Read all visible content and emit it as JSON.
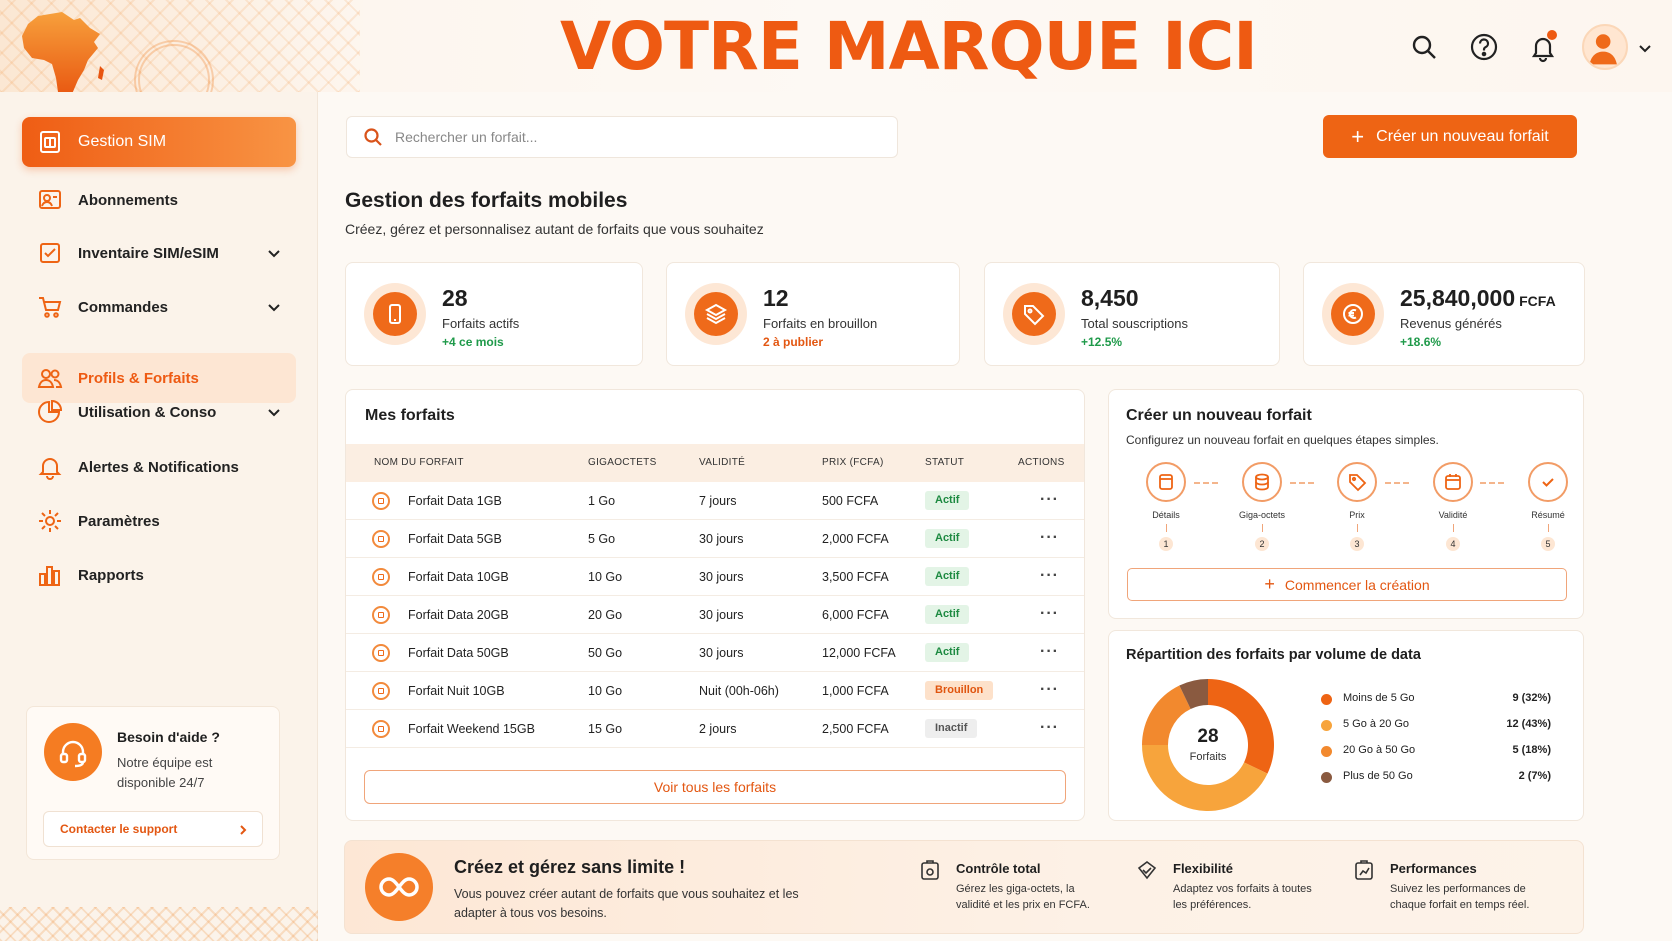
{
  "brand": {
    "title": "VOTRE MARQUE ICI"
  },
  "header": {
    "icons": [
      "search-icon",
      "help-icon",
      "bell-icon",
      "user-icon"
    ]
  },
  "sidebar": {
    "items": [
      {
        "label": "Gestion SIM",
        "icon": "sim-icon",
        "state": "active"
      },
      {
        "label": "Abonnements",
        "icon": "subscription-icon"
      },
      {
        "label": "Inventaire SIM/eSIM",
        "icon": "inventory-icon",
        "expandable": true
      },
      {
        "label": "Commandes",
        "icon": "cart-icon",
        "expandable": true
      },
      {
        "label": "Profils & Forfaits",
        "icon": "users-icon",
        "state": "selected"
      },
      {
        "label": "Utilisation & Conso",
        "icon": "pie-icon",
        "expandable": true
      },
      {
        "label": "Alertes & Notifications",
        "icon": "bell-icon"
      },
      {
        "label": "Paramètres",
        "icon": "gear-icon"
      },
      {
        "label": "Rapports",
        "icon": "report-icon"
      }
    ],
    "help": {
      "title": "Besoin d'aide ?",
      "desc": "Notre équipe est disponible 24/7",
      "button": "Contacter le support"
    }
  },
  "search": {
    "placeholder": "Rechercher un forfait..."
  },
  "create_button": {
    "label": "Créer un nouveau forfait"
  },
  "page": {
    "title": "Gestion des forfaits mobiles",
    "subtitle": "Créez, gérez et personnalisez autant de forfaits que vous souhaitez"
  },
  "stats": [
    {
      "value": "28",
      "unit": "",
      "label": "Forfaits actifs",
      "delta": "+4 ce mois",
      "delta_color": "green"
    },
    {
      "value": "12",
      "unit": "",
      "label": "Forfaits en brouillon",
      "delta": "2 à publier",
      "delta_color": "orange"
    },
    {
      "value": "8,450",
      "unit": "",
      "label": "Total souscriptions",
      "delta": "+12.5%",
      "delta_color": "green"
    },
    {
      "value": "25,840,000",
      "unit": "FCFA",
      "label": "Revenus générés",
      "delta": "+18.6%",
      "delta_color": "green"
    }
  ],
  "table": {
    "title": "Mes forfaits",
    "columns": [
      "NOM DU FORFAIT",
      "GIGAOCTETS",
      "VALIDITÉ",
      "PRIX (FCFA)",
      "STATUT",
      "ACTIONS"
    ],
    "rows": [
      {
        "name": "Forfait Data 1GB",
        "go": "1 Go",
        "validity": "7 jours",
        "price": "500 FCFA",
        "status": "Actif"
      },
      {
        "name": "Forfait Data 5GB",
        "go": "5 Go",
        "validity": "30 jours",
        "price": "2,000 FCFA",
        "status": "Actif"
      },
      {
        "name": "Forfait Data 10GB",
        "go": "10 Go",
        "validity": "30 jours",
        "price": "3,500 FCFA",
        "status": "Actif"
      },
      {
        "name": "Forfait Data 20GB",
        "go": "20 Go",
        "validity": "30 jours",
        "price": "6,000 FCFA",
        "status": "Actif"
      },
      {
        "name": "Forfait Data 50GB",
        "go": "50 Go",
        "validity": "30 jours",
        "price": "12,000 FCFA",
        "status": "Actif"
      },
      {
        "name": "Forfait Nuit 10GB",
        "go": "10 Go",
        "validity": "Nuit (00h-06h)",
        "price": "1,000 FCFA",
        "status": "Brouillon"
      },
      {
        "name": "Forfait Weekend 15GB",
        "go": "15 Go",
        "validity": "2 jours",
        "price": "2,500 FCFA",
        "status": "Inactif"
      }
    ],
    "actions": "···",
    "view_all": "Voir tous les forfaits"
  },
  "wizard": {
    "title": "Créer un nouveau forfait",
    "subtitle": "Configurez un nouveau forfait en quelques étapes simples.",
    "steps": [
      {
        "label": "Détails",
        "num": "1",
        "icon": "document-icon"
      },
      {
        "label": "Giga-octets",
        "num": "2",
        "icon": "database-icon"
      },
      {
        "label": "Prix",
        "num": "3",
        "icon": "tag-icon"
      },
      {
        "label": "Validité",
        "num": "4",
        "icon": "calendar-icon"
      },
      {
        "label": "Résumé",
        "num": "5",
        "icon": "check-icon"
      }
    ],
    "button": "Commencer la création"
  },
  "distribution": {
    "title": "Répartition des forfaits par volume de data",
    "center_value": "28",
    "center_label": "Forfaits"
  },
  "chart_data": {
    "type": "pie",
    "title": "Répartition des forfaits par volume de data",
    "categories": [
      "Moins de 5 Go",
      "5 Go à 20 Go",
      "20 Go à 50 Go",
      "Plus de 50 Go"
    ],
    "values": [
      9,
      12,
      5,
      2
    ],
    "labels": [
      "9 (32%)",
      "12 (43%)",
      "5 (18%)",
      "2 (7%)"
    ],
    "colors": [
      "#ee6414",
      "#f7a43c",
      "#f2892e",
      "#8a5a40"
    ],
    "legend": "right"
  },
  "banner": {
    "title": "Créez et gérez sans limite !",
    "desc": "Vous pouvez créer autant de forfaits que vous souhaitez et les adapter à tous vos besoins.",
    "features": [
      {
        "title": "Contrôle total",
        "desc": "Gérez les giga-octets, la validité et les prix en FCFA.",
        "icon": "control-icon"
      },
      {
        "title": "Flexibilité",
        "desc": "Adaptez vos forfaits à toutes les préférences.",
        "icon": "flex-icon"
      },
      {
        "title": "Performances",
        "desc": "Suivez les performances de chaque forfait en temps réel.",
        "icon": "performance-icon"
      }
    ]
  }
}
